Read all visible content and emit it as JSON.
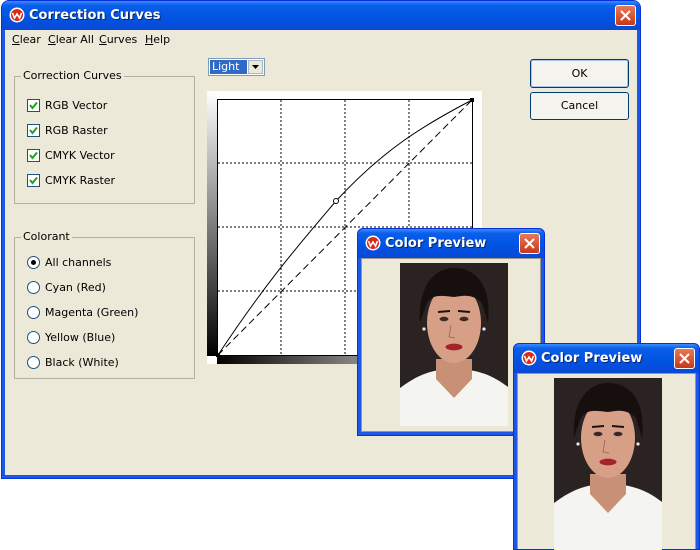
{
  "main_window": {
    "title": "Correction Curves",
    "menu": [
      {
        "label": "Clear"
      },
      {
        "label": "Clear All"
      },
      {
        "label": "Curves"
      },
      {
        "label": "Help"
      }
    ],
    "curves_group": {
      "legend": "Correction Curves",
      "items": [
        {
          "label": "RGB Vector",
          "checked": true
        },
        {
          "label": "RGB Raster",
          "checked": true
        },
        {
          "label": "CMYK Vector",
          "checked": true
        },
        {
          "label": "CMYK Raster",
          "checked": true
        }
      ]
    },
    "colorant_group": {
      "legend": "Colorant",
      "items": [
        {
          "label": "All channels",
          "selected": true
        },
        {
          "label": "Cyan (Red)",
          "selected": false
        },
        {
          "label": "Magenta (Green)",
          "selected": false
        },
        {
          "label": "Yellow (Blue)",
          "selected": false
        },
        {
          "label": "Black (White)",
          "selected": false
        }
      ]
    },
    "mode_dropdown": {
      "value": "Light"
    },
    "ok_label": "OK",
    "cancel_label": "Cancel"
  },
  "preview_windows": [
    {
      "title": "Color Preview"
    },
    {
      "title": "Color Preview"
    }
  ],
  "colors": {
    "titlebar": "#0054e3",
    "window_bg": "#ece9d8",
    "close_button": "#c33a18",
    "selection": "#316ac5"
  },
  "icons": [
    "app-logo-icon",
    "close-icon",
    "checkmark-icon",
    "chevron-down-icon"
  ]
}
